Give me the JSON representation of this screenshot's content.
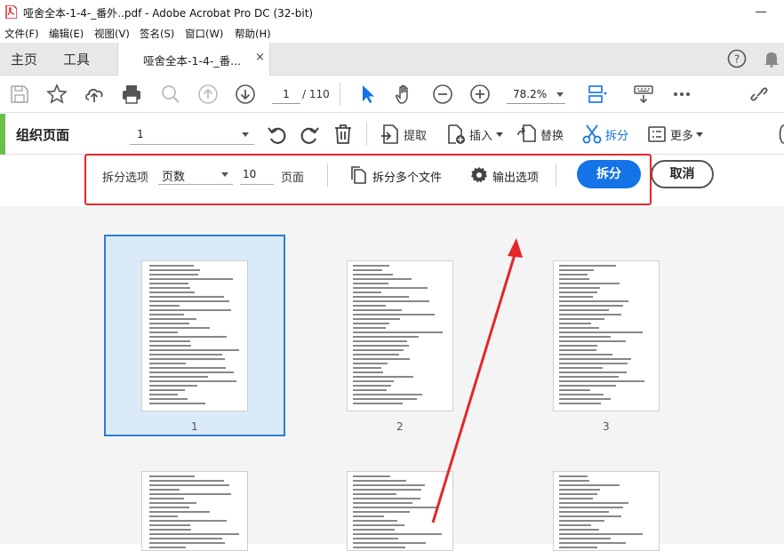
{
  "window": {
    "title": "哑舍全本-1-4-_番外..pdf - Adobe Acrobat Pro DC (32-bit)"
  },
  "menubar": {
    "items": [
      "文件(F)",
      "编辑(E)",
      "视图(V)",
      "签名(S)",
      "窗口(W)",
      "帮助(H)"
    ]
  },
  "tabs": {
    "home": "主页",
    "tools": "工具",
    "document": "哑舍全本-1-4-_番...",
    "close": "×"
  },
  "toolbar": {
    "current_page": "1",
    "total_pages": "/ 110",
    "zoom": "78.2%"
  },
  "organize": {
    "title": "组织页面",
    "page_range": "1",
    "extract": "提取",
    "insert": "插入",
    "replace": "替换",
    "split": "拆分",
    "more": "更多"
  },
  "split_options": {
    "label": "拆分选项",
    "mode": "页数",
    "count": "10",
    "unit": "页面",
    "multiple_files": "拆分多个文件",
    "output_options": "输出选项",
    "split_button": "拆分",
    "cancel_button": "取消"
  },
  "thumbnails": [
    {
      "page": "1",
      "selected": true
    },
    {
      "page": "2",
      "selected": false
    },
    {
      "page": "3",
      "selected": false
    }
  ],
  "colors": {
    "accent_green": "#6cc04a",
    "primary_blue": "#1473e6",
    "annotation_red": "#e5262a",
    "selection_fill": "#dbeaf8"
  }
}
